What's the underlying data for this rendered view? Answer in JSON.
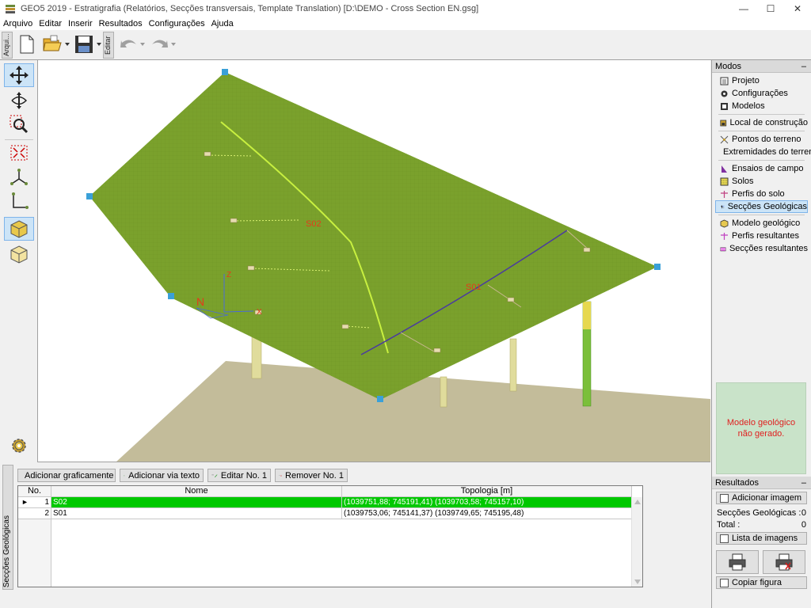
{
  "window": {
    "title": "GEO5 2019 - Estratigrafia (Relatórios, Secções transversais, Template Translation) [D:\\DEMO - Cross Section EN.gsg]",
    "minimize": "—",
    "maximize": "☐",
    "close": "✕"
  },
  "menu": [
    "Arquivo",
    "Editar",
    "Inserir",
    "Resultados",
    "Configurações",
    "Ajuda"
  ],
  "toolbar": {
    "tab_file": "Arqui...",
    "tab_edit": "Editar"
  },
  "viewport": {
    "label_s02": "S02",
    "label_s01": "S01",
    "axis_z": "Z",
    "axis_x": "X",
    "axis_n": "N"
  },
  "modes": {
    "header": "Modos",
    "collapse": "–",
    "groups": [
      [
        "Projeto",
        "Configurações",
        "Modelos"
      ],
      [
        "Local de construção"
      ],
      [
        "Pontos do terreno",
        "Extremidades do terreno"
      ],
      [
        "Ensaios de campo",
        "Solos",
        "Perfis do solo",
        "Secções Geológicas"
      ],
      [
        "Modelo geológico",
        "Perfis resultantes",
        "Secções resultantes"
      ]
    ],
    "active": "Secções Geológicas"
  },
  "status_message": "Modelo geológico não gerado.",
  "results": {
    "header": "Resultados",
    "collapse": "–",
    "add_image": "Adicionar imagem",
    "sections_label": "Secções Geológicas :",
    "sections_value": "0",
    "total_label": "Total :",
    "total_value": "0",
    "image_list": "Lista de imagens",
    "copy_figure": "Copiar figura"
  },
  "bottom": {
    "tab_label": "Secções Geológicas",
    "add_graphic": "Adicionar graficamente",
    "add_text": "Adicionar via texto",
    "edit": "Editar No. 1",
    "remove": "Remover No. 1",
    "columns": [
      "No.",
      "Nome",
      "Topologia [m]"
    ],
    "rows": [
      {
        "no": "1",
        "name": "S02",
        "topology": "(1039751,88; 745191,41) (1039703,58; 745157,10)"
      },
      {
        "no": "2",
        "name": "S01",
        "topology": "(1039753,06; 745141,37) (1039749,65; 745195,48)"
      }
    ]
  },
  "colors": {
    "surface": "#7aa12c",
    "section_line": "#c8f040",
    "selected_row": "#00c800",
    "status_bg": "#c9e3c9",
    "status_text": "#e02020"
  }
}
